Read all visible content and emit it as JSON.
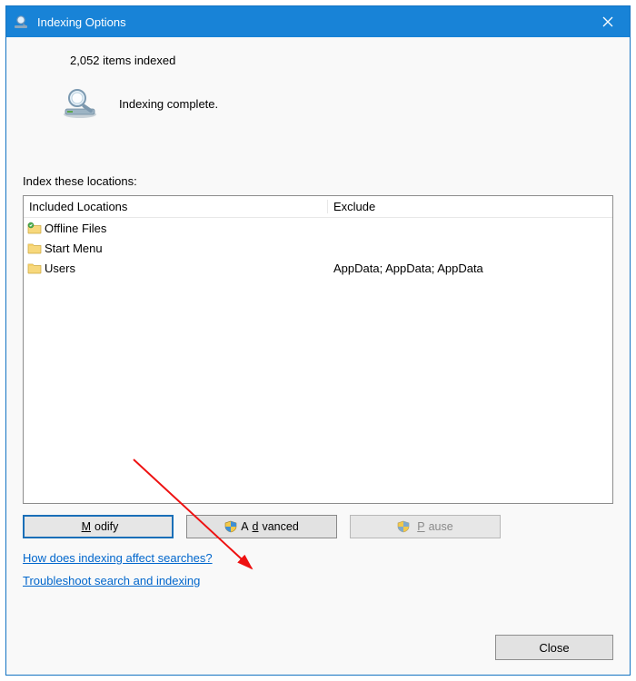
{
  "window": {
    "title": "Indexing Options",
    "close_x": "✕"
  },
  "status": {
    "items_line": "2,052 items indexed",
    "state_line": "Indexing complete."
  },
  "section_label": "Index these locations:",
  "columns": {
    "included": "Included Locations",
    "exclude": "Exclude"
  },
  "rows": [
    {
      "name": "Offline Files",
      "exclude": "",
      "badge": true
    },
    {
      "name": "Start Menu",
      "exclude": "",
      "badge": false
    },
    {
      "name": "Users",
      "exclude": "AppData; AppData; AppData",
      "badge": false
    }
  ],
  "buttons": {
    "modify_pre": "",
    "modify_accel": "M",
    "modify_post": "odify",
    "advanced_pre": "A",
    "advanced_accel": "d",
    "advanced_post": "vanced",
    "pause_pre": "",
    "pause_accel": "P",
    "pause_post": "ause"
  },
  "links": {
    "help": "How does indexing affect searches?",
    "troubleshoot": "Troubleshoot search and indexing"
  },
  "footer": {
    "close": "Close"
  }
}
